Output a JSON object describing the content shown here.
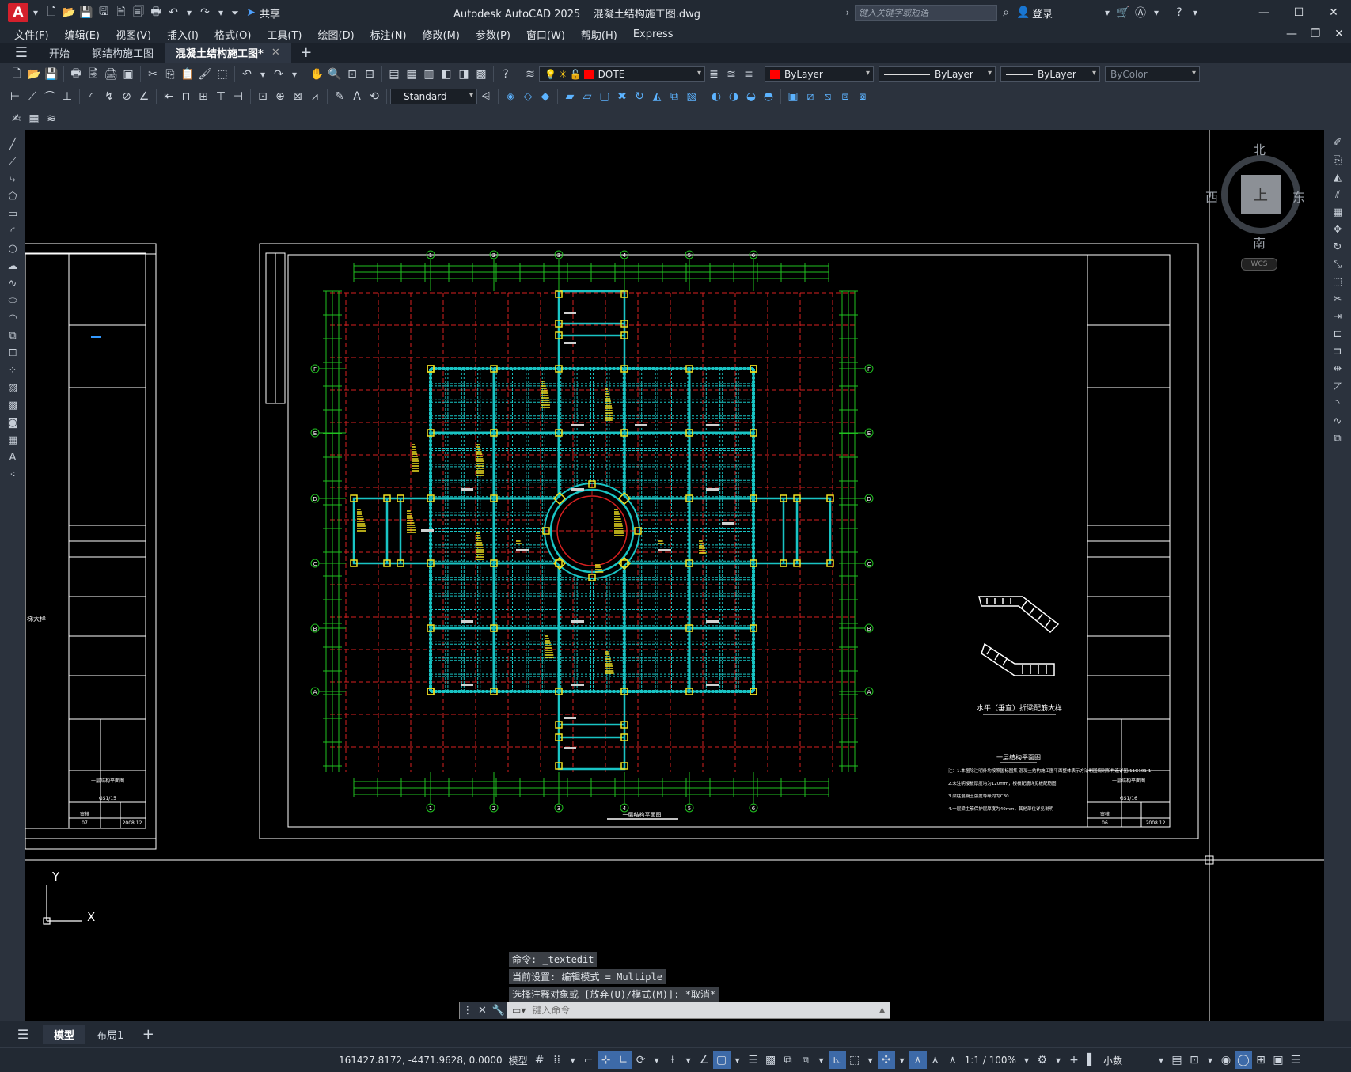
{
  "app": {
    "logo": "A",
    "title": "Autodesk AutoCAD 2025",
    "filename": "混凝土结构施工图.dwg",
    "share_label": "共享",
    "search_placeholder": "键入关键字或短语",
    "login_label": "登录"
  },
  "menu": [
    "文件(F)",
    "编辑(E)",
    "视图(V)",
    "插入(I)",
    "格式(O)",
    "工具(T)",
    "绘图(D)",
    "标注(N)",
    "修改(M)",
    "参数(P)",
    "窗口(W)",
    "帮助(H)",
    "Express"
  ],
  "tabs": [
    {
      "label": "开始",
      "active": false
    },
    {
      "label": "钢结构施工图",
      "active": false
    },
    {
      "label": "混凝土结构施工图*",
      "active": true
    }
  ],
  "toolbar": {
    "layer": "DOTE",
    "color": "ByLayer",
    "linetype": "ByLayer",
    "lineweight": "ByLayer",
    "plotstyle": "ByColor",
    "textstyle": "Standard",
    "layer_color": "#ff0000",
    "color_swatch": "#ff0000"
  },
  "viewcube": {
    "north": "北",
    "south": "南",
    "east": "东",
    "west": "西",
    "face": "上",
    "wcs": "WCS"
  },
  "drawing": {
    "grid_cols": [
      "1",
      "2",
      "3",
      "4",
      "5",
      "6"
    ],
    "grid_rows": [
      "F",
      "E",
      "D",
      "C",
      "B",
      "A"
    ],
    "stair_detail_title": "水平（垂直）折梁配筋大样",
    "plan_title": "一层结构平面图",
    "notes_title": "一层结构平面图",
    "note_lines": [
      "注：1.本图除注明外均按照国标图集 混凝土结构施工图平面整体表示方法制图规则和构造详图(11G101-1)",
      "    2.未注明楼板厚度均为120mm，楼板配筋详见板配筋图",
      "    3.梁柱混凝土强度等级均为C30",
      "    4.一层梁主筋保护层厚度为40mm，其他部位详见说明"
    ],
    "titleblock_right": [
      "GS1/16",
      "审核",
      "06",
      "2008.12"
    ],
    "titleblock_left": [
      "GS1/15",
      "审核",
      "07",
      "2008.12"
    ],
    "left_sheet_label": "一层结构平面图",
    "left_sheet_note": "梯大样"
  },
  "ucs": {
    "y": "Y",
    "x": "X"
  },
  "command": {
    "history": [
      "命令: _textedit",
      "当前设置: 编辑模式 = Multiple",
      "选择注释对象或 [放弃(U)/模式(M)]: *取消*"
    ],
    "placeholder": "键入命令"
  },
  "layouts": [
    {
      "label": "模型",
      "active": true
    },
    {
      "label": "布局1",
      "active": false
    }
  ],
  "status": {
    "coords": "161427.8172, -4471.9628, 0.0000",
    "mode": "模型",
    "scale": "1:1 / 100%",
    "units": "小数"
  }
}
